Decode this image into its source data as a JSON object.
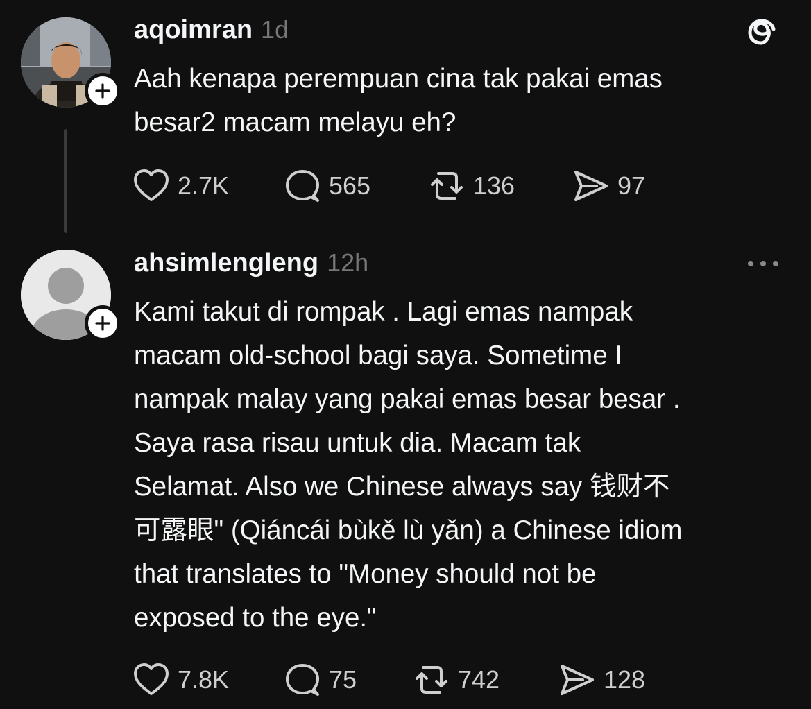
{
  "posts": [
    {
      "username": "aqoimran",
      "timestamp": "1d",
      "text_lines": [
        "Aah kenapa perempuan cina tak pakai emas",
        "besar2 macam melayu eh?"
      ],
      "likes": "2.7K",
      "replies": "565",
      "reposts": "136",
      "shares": "97"
    },
    {
      "username": "ahsimlengleng",
      "timestamp": "12h",
      "text_lines": [
        "Kami takut di rompak .  Lagi emas nampak",
        "macam old-school bagi saya. Sometime I",
        "nampak malay yang pakai emas besar besar .",
        "Saya rasa risau untuk dia. Macam tak",
        "Selamat. Also we Chinese always say 钱财不",
        "可露眼\" (Qiáncái bùkě lù yǎn) a Chinese idiom",
        "that translates to \"Money should not be",
        "exposed to the eye.\""
      ],
      "likes": "7.8K",
      "replies": "75",
      "reposts": "742",
      "shares": "128"
    }
  ],
  "icons": {
    "app": "threads-logo-icon",
    "more": "more-options-icon",
    "like": "heart-icon",
    "reply": "comment-icon",
    "repost": "repost-icon",
    "share": "send-icon",
    "follow": "plus-icon"
  },
  "colors": {
    "background": "#101010",
    "text_primary": "#f3f5f7",
    "text_secondary": "#777777",
    "icon": "#cfcfcf"
  }
}
